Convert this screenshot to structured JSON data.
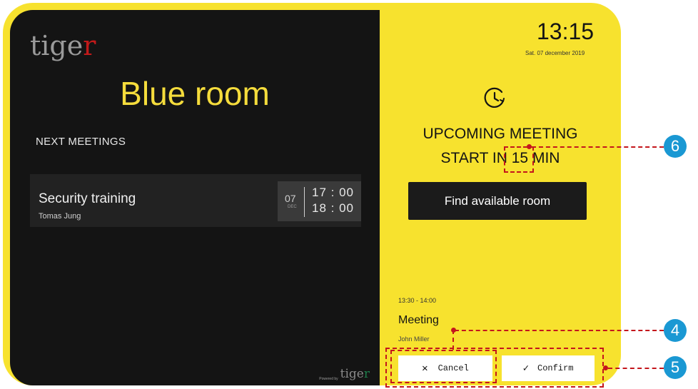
{
  "brand": {
    "logo_main": "tige",
    "logo_accent": "r",
    "powered_label": "Powered by",
    "powered_logo_main": "tige",
    "powered_logo_accent": "r"
  },
  "room": {
    "name": "Blue room",
    "next_meetings_label": "NEXT MEETINGS"
  },
  "meetings": [
    {
      "title": "Security training",
      "organizer": "Tomas Jung",
      "day": "07",
      "month": "DEC",
      "start": "17 : 00",
      "end": "18 : 00"
    }
  ],
  "status": {
    "clock": "13:15",
    "date": "Sat. 07 december 2019",
    "icon": "clock-icon",
    "line1": "UPCOMING MEETING",
    "line2_prefix": "START IN",
    "minutes": "15",
    "line2_suffix": "MIN",
    "find_button": "Find available room"
  },
  "upcoming": {
    "time": "13:30 - 14:00",
    "title": "Meeting",
    "organizer": "John Miller"
  },
  "actions": {
    "cancel": "Cancel",
    "confirm": "Confirm",
    "cancel_icon": "close-icon",
    "confirm_icon": "check-icon"
  },
  "annotations": [
    "6",
    "4",
    "5"
  ],
  "colors": {
    "frame_yellow": "#f7e22e",
    "panel_dark": "#141414",
    "title_yellow": "#f5dc3c",
    "annotation_red": "#c4161c",
    "marker_blue": "#1a98d3"
  }
}
